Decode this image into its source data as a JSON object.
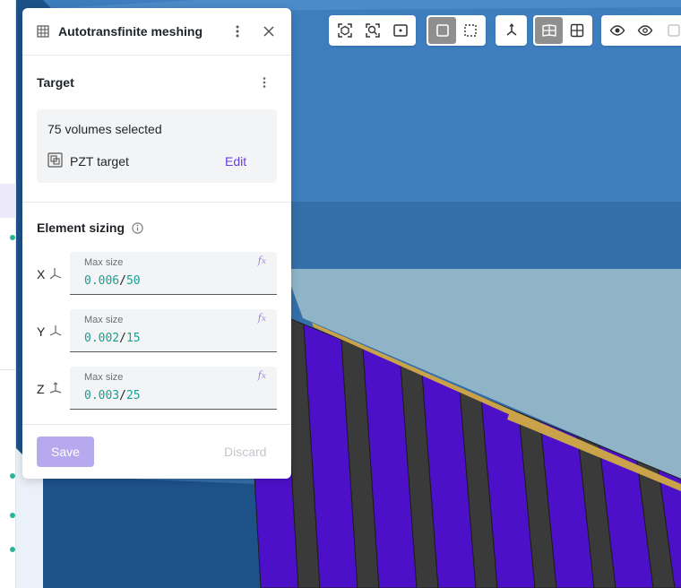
{
  "panel": {
    "title": "Autotransfinite meshing",
    "title_icon": "grid-icon",
    "target": {
      "heading": "Target",
      "selection_text": "75 volumes selected",
      "item_name": "PZT target",
      "item_icon": "volume-group-icon",
      "edit_label": "Edit"
    },
    "element_sizing": {
      "heading": "Element sizing",
      "info_icon": "info-icon",
      "fields": [
        {
          "axis": "X",
          "label": "Max size",
          "size": "0.006",
          "separator": "/",
          "count": "50"
        },
        {
          "axis": "Y",
          "label": "Max size",
          "size": "0.002",
          "separator": "/",
          "count": "15"
        },
        {
          "axis": "Z",
          "label": "Max size",
          "size": "0.003",
          "separator": "/",
          "count": "25"
        }
      ]
    },
    "footer": {
      "save_label": "Save",
      "discard_label": "Discard"
    }
  },
  "toolbar": {
    "groups": [
      [
        "fit-selection-icon",
        "zoom-fit-icon",
        "frame-icon"
      ],
      [
        "solid-view-icon",
        "box-select-icon"
      ],
      [
        "axes-triad-icon"
      ],
      [
        "split-view-icon",
        "grid-view-icon"
      ],
      [
        "visibility-icon",
        "hide-icon"
      ]
    ]
  },
  "colors": {
    "accent": "#6a3fd4",
    "save_disabled": "#b7a9ee",
    "value_teal": "#1a9e92",
    "model_blue_top": "#3f7fbf",
    "model_blue_face": "#2f6aa3",
    "pzt_purple": "#4d10c9",
    "pzt_gray": "#3a3a3a",
    "electrode_gold": "#c9a24a"
  }
}
